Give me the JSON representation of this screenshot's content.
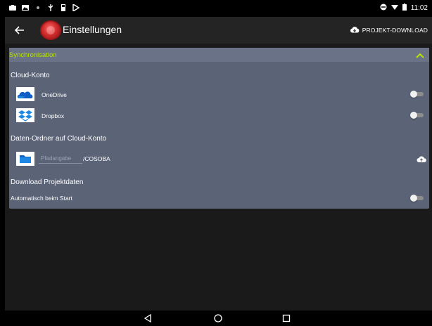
{
  "status_bar": {
    "time": "11:02",
    "icons": [
      "camera-icon",
      "image-icon",
      "wifi-icon",
      "usb-icon",
      "sd-card-icon",
      "play-store-icon",
      "signal-icon",
      "battery-icon"
    ]
  },
  "app_bar": {
    "title": "Einstellungen",
    "action_label": "PROJEKT-DOWNLOAD",
    "back_icon": "arrow-back-icon"
  },
  "panel": {
    "header_label": "Synchronisation",
    "accent_color": "#b9e500",
    "cloud_section_title": "Cloud-Konto",
    "accounts": [
      {
        "label": "OneDrive",
        "icon": "onedrive-icon",
        "enabled": false
      },
      {
        "label": "Dropbox",
        "icon": "dropbox-icon",
        "enabled": false
      }
    ],
    "folder_section_title": "Daten-Ordner auf Cloud-Konto",
    "folder": {
      "placeholder": "Pfadangabe",
      "suffix": "/COSOBA"
    },
    "download_section_title": "Download Projektdaten",
    "auto_start_label": "Automatisch beim Start",
    "auto_start_enabled": false
  }
}
